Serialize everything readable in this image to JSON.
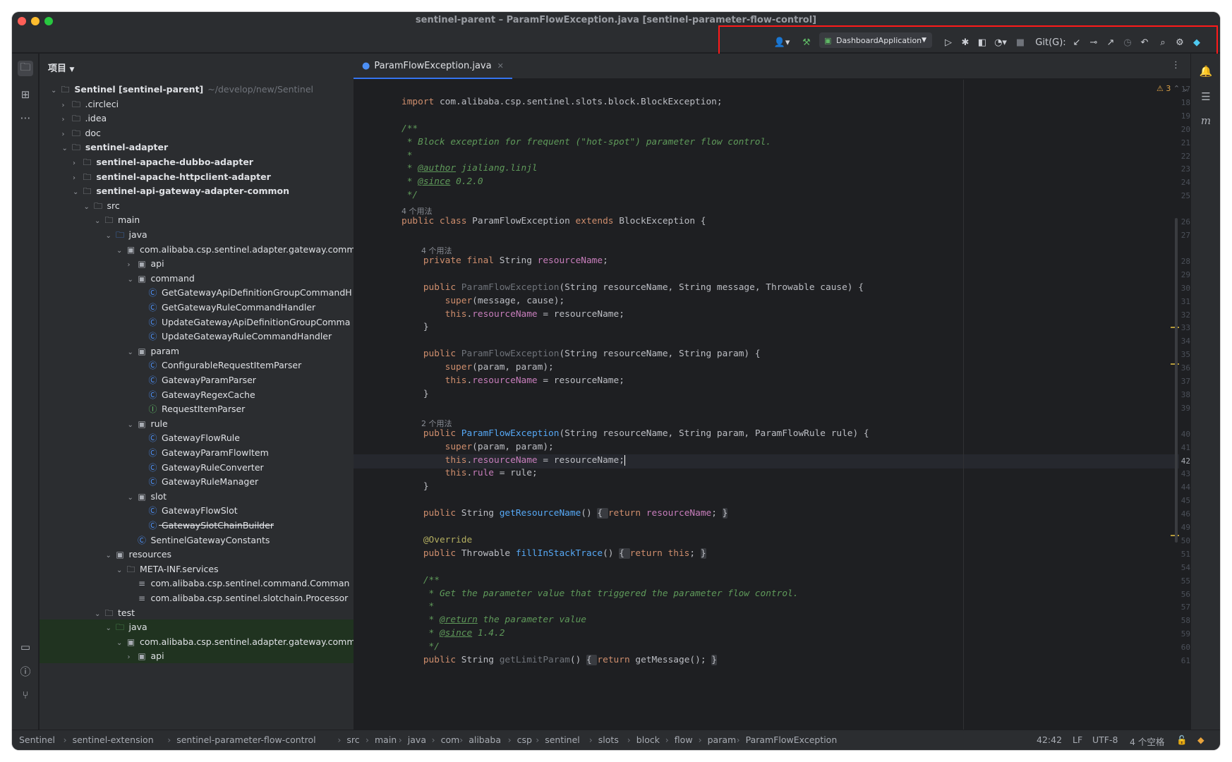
{
  "window": {
    "title": "sentinel-parent – ParamFlowException.java [sentinel-parameter-flow-control]"
  },
  "toolbar": {
    "run_config": "DashboardApplication",
    "git_label": "Git(G):"
  },
  "project": {
    "header": "项目",
    "items": [
      {
        "indent": 0,
        "chev": "v",
        "kind": "folder",
        "text": "Sentinel [sentinel-parent]",
        "suffix": "~/develop/new/Sentinel",
        "bold": true
      },
      {
        "indent": 1,
        "chev": ">",
        "kind": "folder",
        "text": ".circleci"
      },
      {
        "indent": 1,
        "chev": ">",
        "kind": "folder",
        "text": ".idea"
      },
      {
        "indent": 1,
        "chev": ">",
        "kind": "folder",
        "text": "doc"
      },
      {
        "indent": 1,
        "chev": "v",
        "kind": "folder",
        "text": "sentinel-adapter",
        "bold": true
      },
      {
        "indent": 2,
        "chev": ">",
        "kind": "folder",
        "text": "sentinel-apache-dubbo-adapter",
        "bold": true
      },
      {
        "indent": 2,
        "chev": ">",
        "kind": "folder",
        "text": "sentinel-apache-httpclient-adapter",
        "bold": true
      },
      {
        "indent": 2,
        "chev": "v",
        "kind": "folder",
        "text": "sentinel-api-gateway-adapter-common",
        "bold": true
      },
      {
        "indent": 3,
        "chev": "v",
        "kind": "folder",
        "text": "src"
      },
      {
        "indent": 4,
        "chev": "v",
        "kind": "folder",
        "text": "main"
      },
      {
        "indent": 5,
        "chev": "v",
        "kind": "src",
        "text": "java"
      },
      {
        "indent": 6,
        "chev": "v",
        "kind": "pkg",
        "text": "com.alibaba.csp.sentinel.adapter.gateway.comm"
      },
      {
        "indent": 7,
        "chev": ">",
        "kind": "pkg",
        "text": "api"
      },
      {
        "indent": 7,
        "chev": "v",
        "kind": "pkg",
        "text": "command"
      },
      {
        "indent": 8,
        "chev": "",
        "kind": "class",
        "text": "GetGatewayApiDefinitionGroupCommandH"
      },
      {
        "indent": 8,
        "chev": "",
        "kind": "class",
        "text": "GetGatewayRuleCommandHandler"
      },
      {
        "indent": 8,
        "chev": "",
        "kind": "class",
        "text": "UpdateGatewayApiDefinitionGroupComma"
      },
      {
        "indent": 8,
        "chev": "",
        "kind": "class",
        "text": "UpdateGatewayRuleCommandHandler"
      },
      {
        "indent": 7,
        "chev": "v",
        "kind": "pkg",
        "text": "param"
      },
      {
        "indent": 8,
        "chev": "",
        "kind": "class",
        "text": "ConfigurableRequestItemParser"
      },
      {
        "indent": 8,
        "chev": "",
        "kind": "class",
        "text": "GatewayParamParser"
      },
      {
        "indent": 8,
        "chev": "",
        "kind": "class",
        "text": "GatewayRegexCache"
      },
      {
        "indent": 8,
        "chev": "",
        "kind": "intf",
        "text": "RequestItemParser"
      },
      {
        "indent": 7,
        "chev": "v",
        "kind": "pkg",
        "text": "rule"
      },
      {
        "indent": 8,
        "chev": "",
        "kind": "class",
        "text": "GatewayFlowRule"
      },
      {
        "indent": 8,
        "chev": "",
        "kind": "class",
        "text": "GatewayParamFlowItem"
      },
      {
        "indent": 8,
        "chev": "",
        "kind": "class",
        "text": "GatewayRuleConverter"
      },
      {
        "indent": 8,
        "chev": "",
        "kind": "class",
        "text": "GatewayRuleManager"
      },
      {
        "indent": 7,
        "chev": "v",
        "kind": "pkg",
        "text": "slot"
      },
      {
        "indent": 8,
        "chev": "",
        "kind": "class",
        "text": "GatewayFlowSlot"
      },
      {
        "indent": 8,
        "chev": "",
        "kind": "class",
        "text": "GatewaySlotChainBuilder",
        "strike": true
      },
      {
        "indent": 7,
        "chev": "",
        "kind": "class",
        "text": "SentinelGatewayConstants"
      },
      {
        "indent": 5,
        "chev": "v",
        "kind": "res",
        "text": "resources"
      },
      {
        "indent": 6,
        "chev": "v",
        "kind": "folder",
        "text": "META-INF.services"
      },
      {
        "indent": 7,
        "chev": "",
        "kind": "file",
        "text": "com.alibaba.csp.sentinel.command.Comman"
      },
      {
        "indent": 7,
        "chev": "",
        "kind": "file",
        "text": "com.alibaba.csp.sentinel.slotchain.Processor"
      },
      {
        "indent": 4,
        "chev": "v",
        "kind": "folder",
        "text": "test"
      },
      {
        "indent": 5,
        "chev": "v",
        "kind": "test",
        "text": "java",
        "sel": true
      },
      {
        "indent": 6,
        "chev": "v",
        "kind": "pkg",
        "text": "com.alibaba.csp.sentinel.adapter.gateway.comm",
        "sel": true
      },
      {
        "indent": 7,
        "chev": ">",
        "kind": "pkg",
        "text": "api",
        "sel": true
      }
    ]
  },
  "editor": {
    "tab": "ParamFlowException.java",
    "warnings": "3",
    "lines": [
      {
        "n": "17",
        "html": ""
      },
      {
        "n": "18",
        "html": "<span class='kw'>import</span> com.alibaba.csp.sentinel.slots.block.BlockException;"
      },
      {
        "n": "19",
        "html": ""
      },
      {
        "n": "20",
        "html": "<span class='cm'>/**</span>"
      },
      {
        "n": "21",
        "html": "<span class='cm'> * Block exception for frequent (\"hot-spot\") parameter flow control.</span>"
      },
      {
        "n": "22",
        "html": "<span class='cm'> *</span>"
      },
      {
        "n": "23",
        "html": "<span class='cm'> * </span><span class='doctag'>@author</span><span class='cm'> jialiang.linjl</span>"
      },
      {
        "n": "24",
        "html": "<span class='cm'> * </span><span class='doctag'>@since</span><span class='cm'> 0.2.0</span>"
      },
      {
        "n": "25",
        "html": "<span class='cm'> */</span>"
      },
      {
        "hint": "4 个用法"
      },
      {
        "n": "26",
        "html": "<span class='kw'>public class</span> ParamFlowException <span class='kw'>extends</span> BlockException {"
      },
      {
        "n": "27",
        "html": ""
      },
      {
        "hint": "4 个用法",
        "ind": true
      },
      {
        "n": "28",
        "html": "    <span class='kw'>private final</span> String <span class='fld'>resourceName</span>;"
      },
      {
        "n": "29",
        "html": ""
      },
      {
        "n": "30",
        "html": "    <span class='kw'>public</span> <span style='color:#6f737a'>ParamFlowException</span>(String resourceName, String message, Throwable cause) {"
      },
      {
        "n": "31",
        "html": "        <span class='kw'>super</span>(message, cause);"
      },
      {
        "n": "32",
        "html": "        <span class='kw'>this</span>.<span class='fld'>resourceName</span> = resourceName;"
      },
      {
        "n": "33",
        "html": "    }"
      },
      {
        "n": "34",
        "html": ""
      },
      {
        "n": "35",
        "html": "    <span class='kw'>public</span> <span style='color:#6f737a'>ParamFlowException</span>(String resourceName, String param) {"
      },
      {
        "n": "36",
        "html": "        <span class='kw'>super</span>(param, param);"
      },
      {
        "n": "37",
        "html": "        <span class='kw'>this</span>.<span class='fld'>resourceName</span> = resourceName;"
      },
      {
        "n": "38",
        "html": "    }"
      },
      {
        "n": "39",
        "html": ""
      },
      {
        "hint": "2 个用法",
        "ind": true
      },
      {
        "n": "40",
        "html": "    <span class='kw'>public</span> <span class='fn' style='color:#56a8f5'>ParamFlowException</span>(String resourceName, String param, ParamFlowRule rule) {"
      },
      {
        "n": "41",
        "html": "        <span class='kw'>super</span>(param, param);"
      },
      {
        "n": "42",
        "html": "        <span class='kw'>this</span>.<span class='fld'>resourceName</span> = resourceName;<span style='border-left:1px solid #fff'></span>",
        "cur": true
      },
      {
        "n": "43",
        "html": "        <span class='kw'>this</span>.<span class='fld'>rule</span> = rule;"
      },
      {
        "n": "44",
        "html": "    }"
      },
      {
        "n": "45",
        "html": ""
      },
      {
        "n": "46",
        "html": "    <span class='kw'>public</span> String <span class='fn'>getResourceName</span>() <span class='fold-r'>{ </span><span class='kw'>return</span> <span class='fld'>resourceName</span>; <span class='fold-r'>}</span>"
      },
      {
        "n": "49",
        "html": ""
      },
      {
        "n": "50",
        "html": "    <span class='ann'>@Override</span>"
      },
      {
        "n": "51",
        "html": "    <span class='kw'>public</span> Throwable <span class='fn'>fillInStackTrace</span>() <span class='fold-r'>{ </span><span class='kw'>return this</span>; <span class='fold-r'>}</span>"
      },
      {
        "n": "54",
        "html": ""
      },
      {
        "n": "55",
        "html": "    <span class='cm'>/**</span>"
      },
      {
        "n": "56",
        "html": "    <span class='cm'> * Get the parameter value that triggered the parameter flow control.</span>"
      },
      {
        "n": "57",
        "html": "    <span class='cm'> *</span>"
      },
      {
        "n": "58",
        "html": "    <span class='cm'> * </span><span class='doctag'>@return</span><span class='cm'> the parameter value</span>"
      },
      {
        "n": "59",
        "html": "    <span class='cm'> * </span><span class='doctag'>@since</span><span class='cm'> 1.4.2</span>"
      },
      {
        "n": "60",
        "html": "    <span class='cm'> */</span>"
      },
      {
        "n": "61",
        "html": "    <span class='kw'>public</span> String <span style='color:#6f737a'>getLimitParam</span>() <span class='fold-r'>{ </span><span class='kw'>return</span> getMessage(); <span class='fold-r'>}</span>"
      }
    ]
  },
  "breadcrumb": [
    "Sentinel",
    "sentinel-extension",
    "sentinel-parameter-flow-control",
    "src",
    "main",
    "java",
    "com",
    "alibaba",
    "csp",
    "sentinel",
    "slots",
    "block",
    "flow",
    "param",
    "ParamFlowException"
  ],
  "status": {
    "position": "42:42",
    "line_sep": "LF",
    "encoding": "UTF-8",
    "indent": "4 个空格"
  }
}
